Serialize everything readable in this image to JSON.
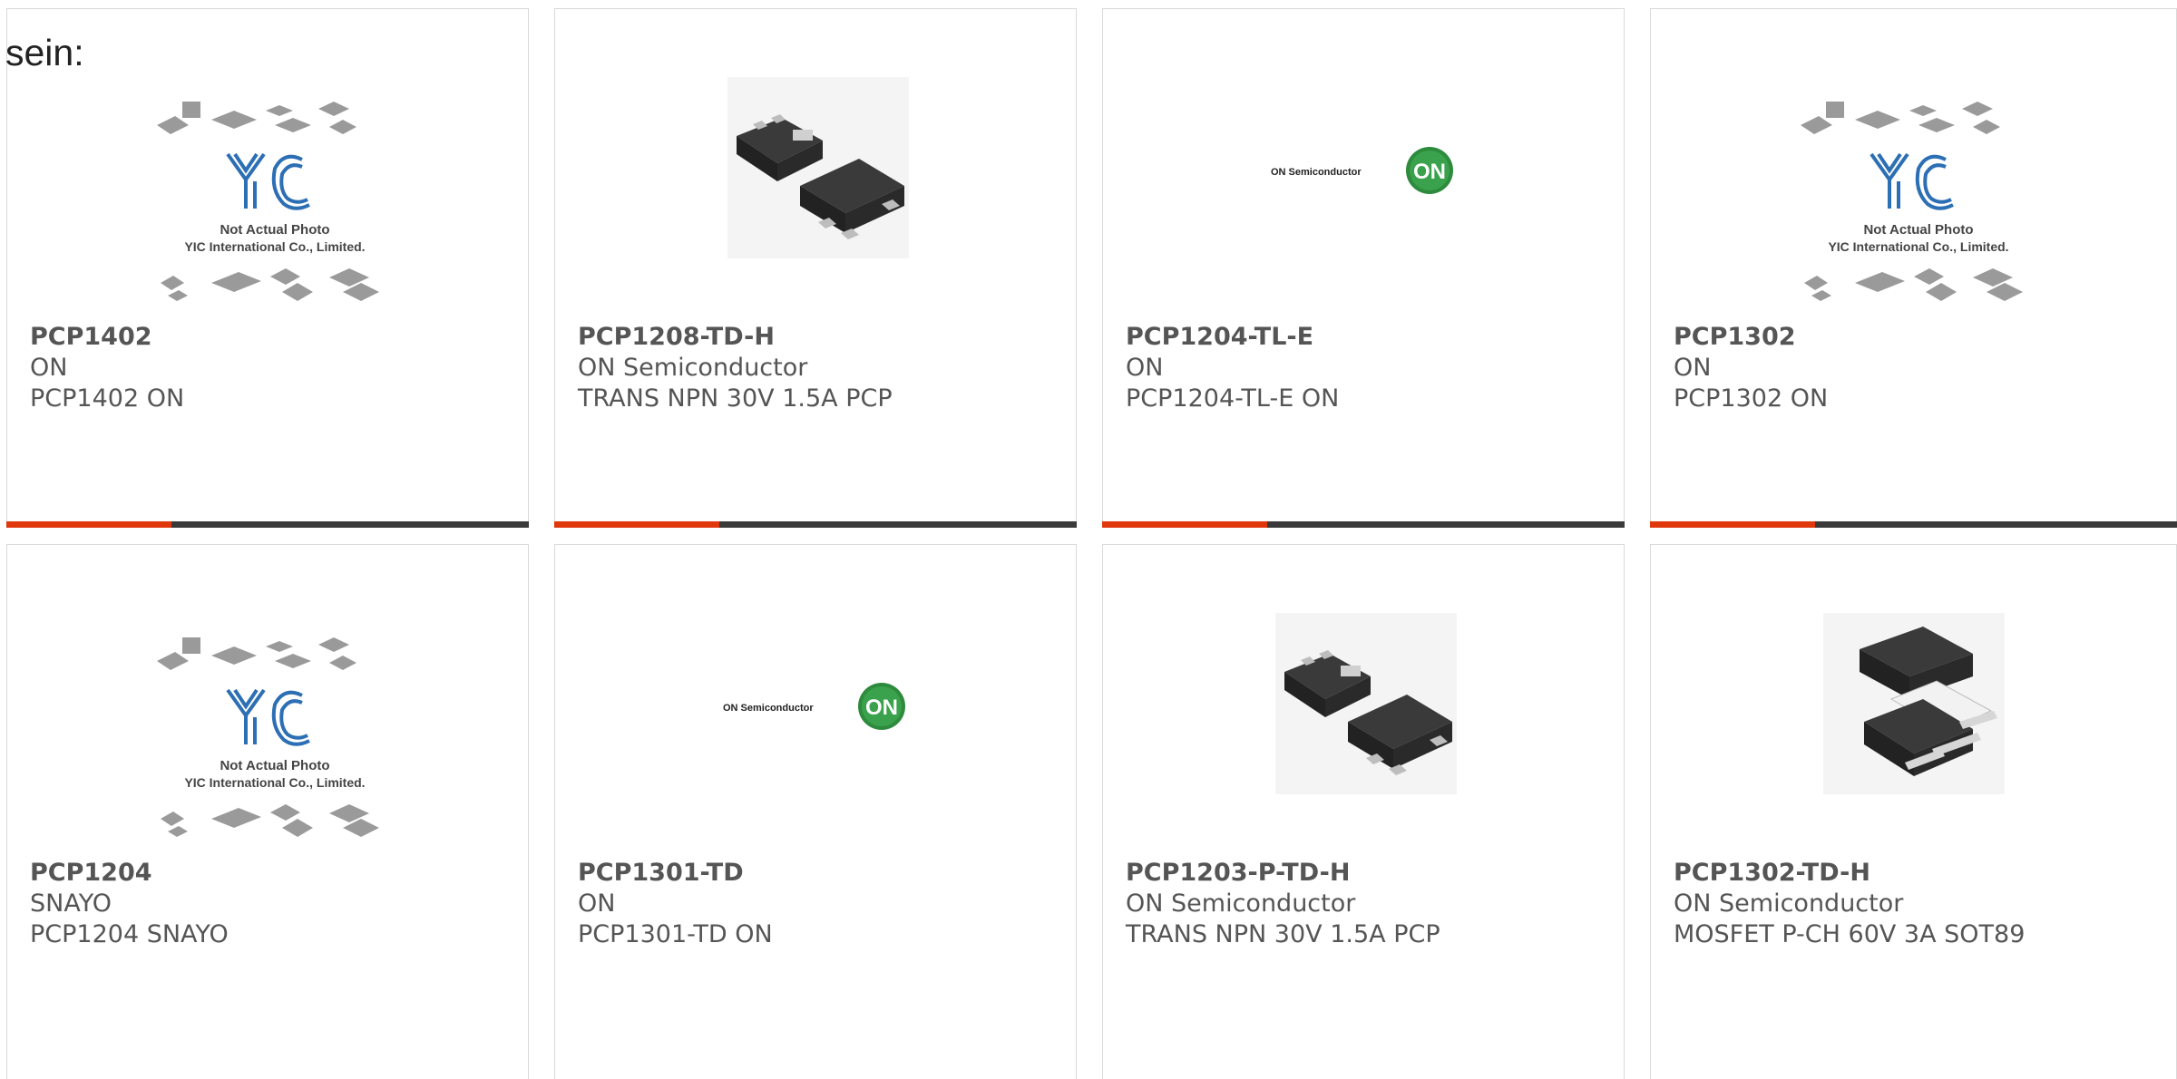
{
  "intro_text": "sein:",
  "placeholder_image": {
    "line1": "Not Actual Photo",
    "line2": "YIC International Co., Limited.",
    "logo_text": "YIC"
  },
  "on_logo": {
    "brand_text": "ON Semiconductor",
    "badge_text": "ON"
  },
  "products": [
    {
      "part": "PCP1402",
      "manufacturer": "ON",
      "description": "PCP1402 ON",
      "image": "yic-placeholder"
    },
    {
      "part": "PCP1208-TD-H",
      "manufacturer": "ON Semiconductor",
      "description": "TRANS NPN 30V 1.5A PCP",
      "image": "sot89-package"
    },
    {
      "part": "PCP1204-TL-E",
      "manufacturer": "ON",
      "description": "PCP1204-TL-E ON",
      "image": "on-semi-logo"
    },
    {
      "part": "PCP1302",
      "manufacturer": "ON",
      "description": "PCP1302 ON",
      "image": "yic-placeholder"
    },
    {
      "part": "PCP1204",
      "manufacturer": "SNAYO",
      "description": "PCP1204 SNAYO",
      "image": "yic-placeholder"
    },
    {
      "part": "PCP1301-TD",
      "manufacturer": "ON",
      "description": "PCP1301-TD ON",
      "image": "on-semi-logo"
    },
    {
      "part": "PCP1203-P-TD-H",
      "manufacturer": "ON Semiconductor",
      "description": "TRANS NPN 30V 1.5A PCP",
      "image": "sot89-package"
    },
    {
      "part": "PCP1302-TD-H",
      "manufacturer": "ON Semiconductor",
      "description": "MOSFET P-CH 60V 3A SOT89",
      "image": "sot89-package-alt"
    }
  ],
  "colors": {
    "accent_bar": "#e0370d",
    "dark_bar": "#3a3a3a",
    "text": "#555555",
    "card_border": "#d9d9d9",
    "yic_blue": "#2c6fb4",
    "on_green": "#2e8b3d"
  }
}
